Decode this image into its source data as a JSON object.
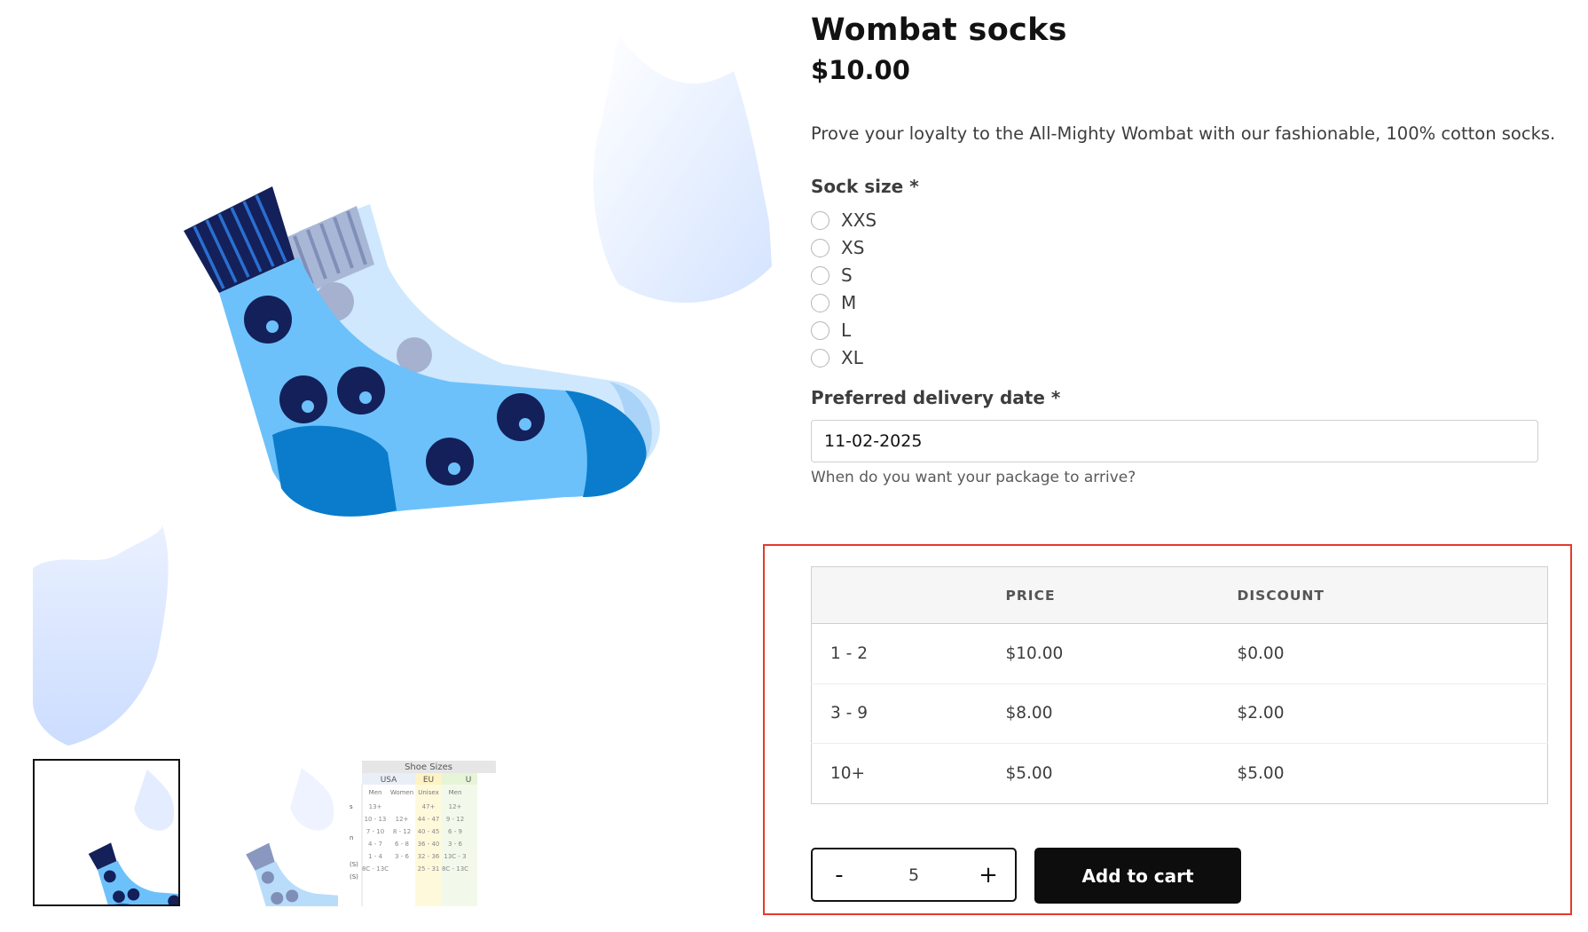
{
  "product": {
    "title": "Wombat socks",
    "price": "$10.00",
    "description": "Prove your loyalty to the All-Mighty Wombat with our fashionable, 100% cotton socks."
  },
  "sock_size": {
    "label": "Sock size *",
    "options": [
      "XXS",
      "XS",
      "S",
      "M",
      "L",
      "XL"
    ]
  },
  "delivery": {
    "label": "Preferred delivery date *",
    "value": "11-02-2025",
    "helper": "When do you want your package to arrive?"
  },
  "discount_table": {
    "headers": [
      "",
      "PRICE",
      "DISCOUNT"
    ],
    "rows": [
      [
        "1 - 2",
        "$10.00",
        "$0.00"
      ],
      [
        "3 - 9",
        "$8.00",
        "$2.00"
      ],
      [
        "10+",
        "$5.00",
        "$5.00"
      ]
    ]
  },
  "quantity": {
    "minus": "-",
    "value": "5",
    "plus": "+"
  },
  "add_to_cart_label": "Add to cart",
  "size_chart_thumb": {
    "title": "Shoe Sizes",
    "regions": [
      "USA",
      "EU",
      "U"
    ],
    "subheaders": [
      "Men",
      "Women",
      "Unisex",
      "Men"
    ],
    "rows": [
      [
        "13+",
        "",
        "47+",
        "12+"
      ],
      [
        "10 - 13",
        "12+",
        "44 - 47",
        "9 - 12"
      ],
      [
        "7 - 10",
        "8 - 12",
        "40 - 45",
        "6 - 9"
      ],
      [
        "4 - 7",
        "6 - 8",
        "36 - 40",
        "3 - 6"
      ],
      [
        "1 - 4",
        "3 - 6",
        "32 - 36",
        "13C - 3"
      ],
      [
        "8C - 13C",
        "",
        "25 - 31",
        "8C - 13C"
      ]
    ],
    "side_labels": [
      "s",
      "n",
      "(S)",
      "(S)"
    ]
  },
  "colors": {
    "highlight": "#e53a2c",
    "button": "#0d0d0d",
    "sock_light": "#6cc1fb",
    "sock_dark": "#0a7ccb",
    "sock_navy": "#14205a"
  }
}
